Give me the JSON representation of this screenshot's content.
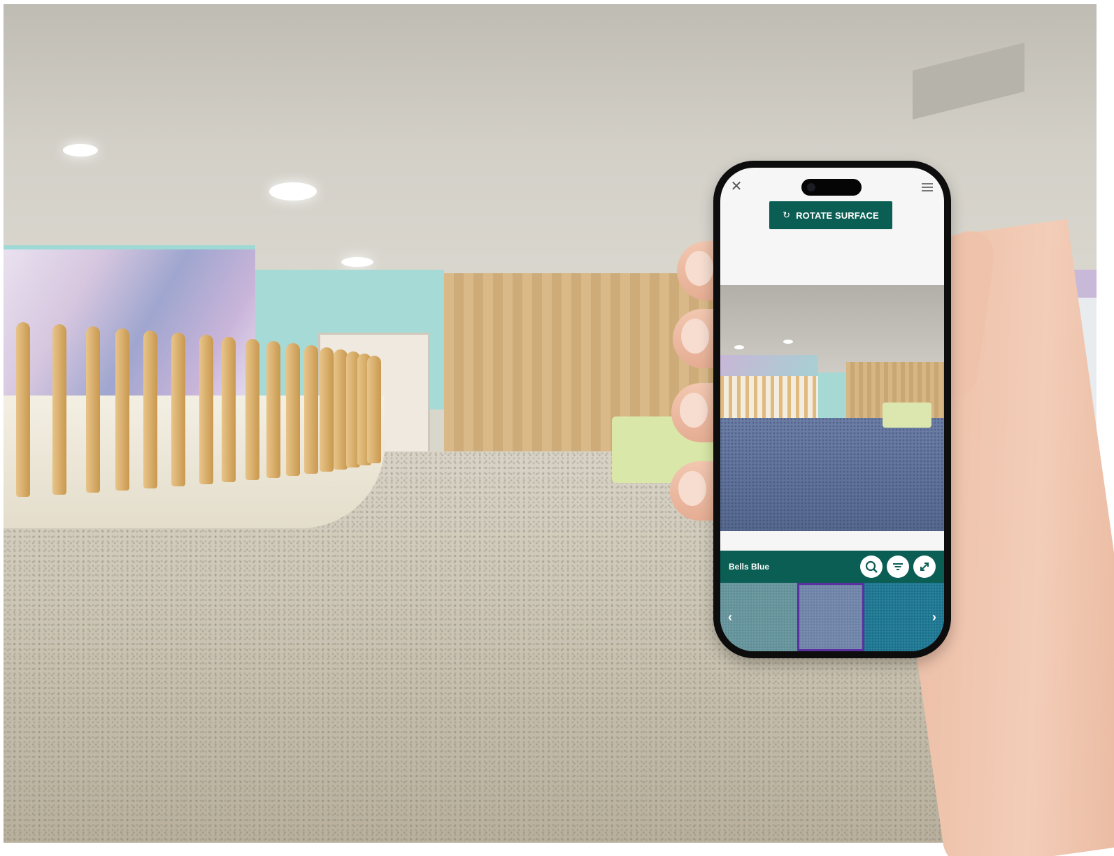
{
  "app": {
    "rotate_label": "ROTATE SURFACE",
    "rotate_icon": "rotate-icon",
    "close_icon": "close-icon",
    "menu_icon": "hamburger-menu-icon"
  },
  "toolbar": {
    "swatch_name": "Bells Blue",
    "tools": [
      {
        "icon": "search-icon"
      },
      {
        "icon": "filter-icon"
      },
      {
        "icon": "expand-icon"
      }
    ]
  },
  "swatches": {
    "items": [
      {
        "color": "#5f8f97",
        "selected": false
      },
      {
        "color": "#6a7fa5",
        "selected": true
      },
      {
        "color": "#16718d",
        "selected": false
      }
    ],
    "prev_icon": "chevron-left-icon",
    "next_icon": "chevron-right-icon"
  },
  "colors": {
    "brand_green": "#0b5e54",
    "selected_outline": "#5a2fa0"
  }
}
